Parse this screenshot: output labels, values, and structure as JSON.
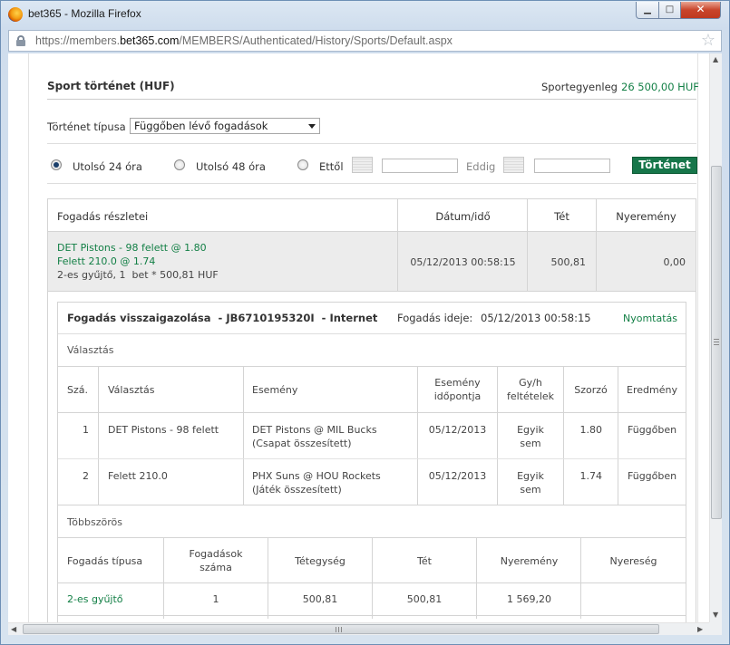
{
  "window": {
    "title": "bet365 - Mozilla Firefox",
    "url_prefix": "https://members.",
    "url_domain": "bet365.com",
    "url_path": "/MEMBERS/Authenticated/History/Sports/Default.aspx"
  },
  "header": {
    "title": "Sport történet (HUF)",
    "balance_label": "Sportegyenleg",
    "balance_value": "26 500,00 HUF"
  },
  "filter": {
    "type_label": "Történet típusa",
    "type_value": "Függőben lévő fogadások",
    "radio_24": "Utolsó 24 óra",
    "radio_48": "Utolsó 48 óra",
    "radio_from": "Ettől",
    "until_label": "Eddig",
    "button": "Történet",
    "selected": "24"
  },
  "table": {
    "headers": {
      "details": "Fogadás részletei",
      "datetime": "Dátum/idő",
      "stake": "Tét",
      "winnings": "Nyeremény"
    },
    "bet": {
      "line1": "DET Pistons - 98 felett @ 1.80",
      "line2": "Felett 210.0 @ 1.74",
      "line3": "2-es gyűjtő, 1  bet * 500,81 HUF",
      "datetime": "05/12/2013 00:58:15",
      "stake": "500,81",
      "winnings": "0,00"
    }
  },
  "confirmation": {
    "title": "Fogadás visszaigazolása  - JB6710195320I  - Internet",
    "time_label": "Fogadás ideje:",
    "time_value": "05/12/2013 00:58:15",
    "print": "Nyomtatás",
    "selection_section": "Választás",
    "sel_headers": {
      "num": "Szá.",
      "selection": "Választás",
      "event": "Esemény",
      "event_time_1": "Esemény",
      "event_time_2": "időpontja",
      "cond_1": "Gy/h",
      "cond_2": "feltételek",
      "odds": "Szorzó",
      "result": "Eredmény"
    },
    "selections": [
      {
        "num": "1",
        "selection": "DET Pistons - 98 felett",
        "event_1": "DET Pistons @ MIL Bucks",
        "event_2": "(Csapat összesített)",
        "date": "05/12/2013",
        "cond_1": "Egyik",
        "cond_2": "sem",
        "odds": "1.80",
        "result": "Függőben"
      },
      {
        "num": "2",
        "selection": "Felett 210.0",
        "event_1": "PHX Suns @ HOU Rockets",
        "event_2": "(Játék összesített)",
        "date": "05/12/2013",
        "cond_1": "Egyik",
        "cond_2": "sem",
        "odds": "1.74",
        "result": "Függőben"
      }
    ],
    "multiple_section": "Többszörös",
    "mult_headers": {
      "type": "Fogadás típusa",
      "count_1": "Fogadások",
      "count_2": "száma",
      "unit": "Tétegység",
      "stake": "Tét",
      "winnings": "Nyeremény",
      "profit": "Nyereség"
    },
    "multiple": {
      "type": "2-es gyűjtő",
      "count": "1",
      "unit": "500,81",
      "stake": "500,81",
      "winnings": "1 569,20",
      "profit": ""
    }
  }
}
